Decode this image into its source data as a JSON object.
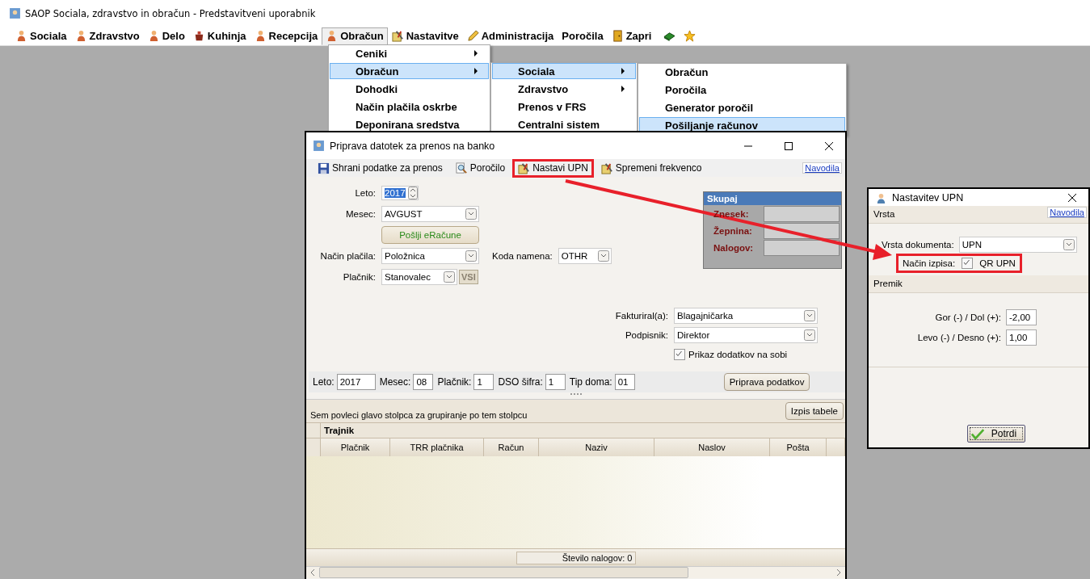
{
  "app_window": {
    "title": "SAOP Sociala, zdravstvo in obračun - Predstavitveni uporabnik"
  },
  "menubar": [
    {
      "label": "Sociala",
      "selected": false
    },
    {
      "label": "Zdravstvo",
      "selected": false
    },
    {
      "label": "Delo",
      "selected": false
    },
    {
      "label": "Kuhinja",
      "selected": false
    },
    {
      "label": "Recepcija",
      "selected": false
    },
    {
      "label": "Obračun",
      "selected": true
    },
    {
      "label": "Nastavitve",
      "selected": false
    },
    {
      "label": "Administracija",
      "selected": false
    },
    {
      "label": "Poročila",
      "selected": false
    },
    {
      "label": "Zapri",
      "selected": false
    }
  ],
  "menus": [
    {
      "items": [
        {
          "label": "Ceniki",
          "submenu": true,
          "selected": false
        },
        {
          "label": "Obračun",
          "submenu": true,
          "selected": true
        },
        {
          "label": "Dohodki",
          "submenu": false,
          "selected": false
        },
        {
          "label": "Način plačila oskrbe",
          "submenu": false,
          "selected": false
        },
        {
          "label": "Deponirana sredstva",
          "submenu": false,
          "selected": false
        }
      ]
    },
    {
      "items": [
        {
          "label": "Sociala",
          "submenu": true,
          "selected": true
        },
        {
          "label": "Zdravstvo",
          "submenu": true,
          "selected": false
        },
        {
          "label": "Prenos v FRS",
          "submenu": false,
          "selected": false
        },
        {
          "label": "Centralni sistem",
          "submenu": false,
          "selected": false
        }
      ]
    },
    {
      "items": [
        {
          "label": "Obračun",
          "submenu": false,
          "selected": false
        },
        {
          "label": "Poročila",
          "submenu": false,
          "selected": false
        },
        {
          "label": "Generator poročil",
          "submenu": false,
          "selected": false
        },
        {
          "label": "Pošiljanje računov",
          "submenu": false,
          "selected": true
        }
      ]
    }
  ],
  "dialog": {
    "title": "Priprava datotek za prenos na banko",
    "toolbar": [
      {
        "label": "Shrani podatke za prenos",
        "highlighted": false
      },
      {
        "label": "Poročilo",
        "highlighted": false
      },
      {
        "label": "Nastavi UPN",
        "highlighted": true
      },
      {
        "label": "Spremeni frekvenco",
        "highlighted": false
      }
    ],
    "help_link": "Navodila",
    "leto": {
      "label": "Leto:",
      "value": "2017",
      "text_selected": true
    },
    "mesec": {
      "label": "Mesec:",
      "value": "AVGUST"
    },
    "send_button": "Pošlji eRačune",
    "nacin_placila": {
      "label": "Način plačila:",
      "value": "Položnica"
    },
    "koda_namena": {
      "label": "Koda namena:",
      "value": "OTHR"
    },
    "placnik": {
      "label": "Plačnik:",
      "value": "Stanovalec"
    },
    "all_button": "VSI",
    "summary": {
      "title": "Skupaj",
      "fields": [
        {
          "label": "Znesek:"
        },
        {
          "label": "Žepnina:"
        },
        {
          "label": "Nalogov:"
        }
      ]
    },
    "fakturiral": {
      "label": "Fakturiral(a):",
      "value": "Blagajničarka"
    },
    "podpisnik": {
      "label": "Podpisnik:",
      "value": "Direktor"
    },
    "prikaz": {
      "label": "Prikaz dodatkov na sobi",
      "checked": true
    },
    "filter_bar": [
      {
        "label": "Leto:",
        "value": "2017"
      },
      {
        "label": "Mesec:",
        "value": "08"
      },
      {
        "label": "Plačnik:",
        "value": "1"
      },
      {
        "label": "DSO šifra:",
        "value": "1"
      },
      {
        "label": "Tip doma:",
        "value": "01"
      }
    ],
    "prepare_button": "Priprava podatkov",
    "grid": {
      "group_hint": "Sem povleci glavo stolpca za grupiranje po tem stolpcu",
      "print_button": "Izpis tabele",
      "band": "Trajnik",
      "columns": [
        "Plačnik",
        "TRR plačnika",
        "Račun",
        "Naziv",
        "Naslov",
        "Pošta"
      ],
      "footer": "Število nalogov: 0"
    }
  },
  "upn_dialog": {
    "title": "Nastavitev UPN",
    "section_1": "Vrsta",
    "help_link": "Navodila",
    "vrsta_dokumenta": {
      "label": "Vrsta dokumenta:",
      "value": "UPN"
    },
    "nacin_izpisa": {
      "label": "Način izpisa:",
      "option": "QR UPN",
      "checked": true,
      "highlighted": true
    },
    "section_2": "Premik",
    "offsets": [
      {
        "label": "Gor (-) / Dol (+):",
        "value": "-2,00"
      },
      {
        "label": "Levo (-) / Desno (+):",
        "value": "1,00"
      }
    ],
    "confirm_button": "Potrdi"
  }
}
